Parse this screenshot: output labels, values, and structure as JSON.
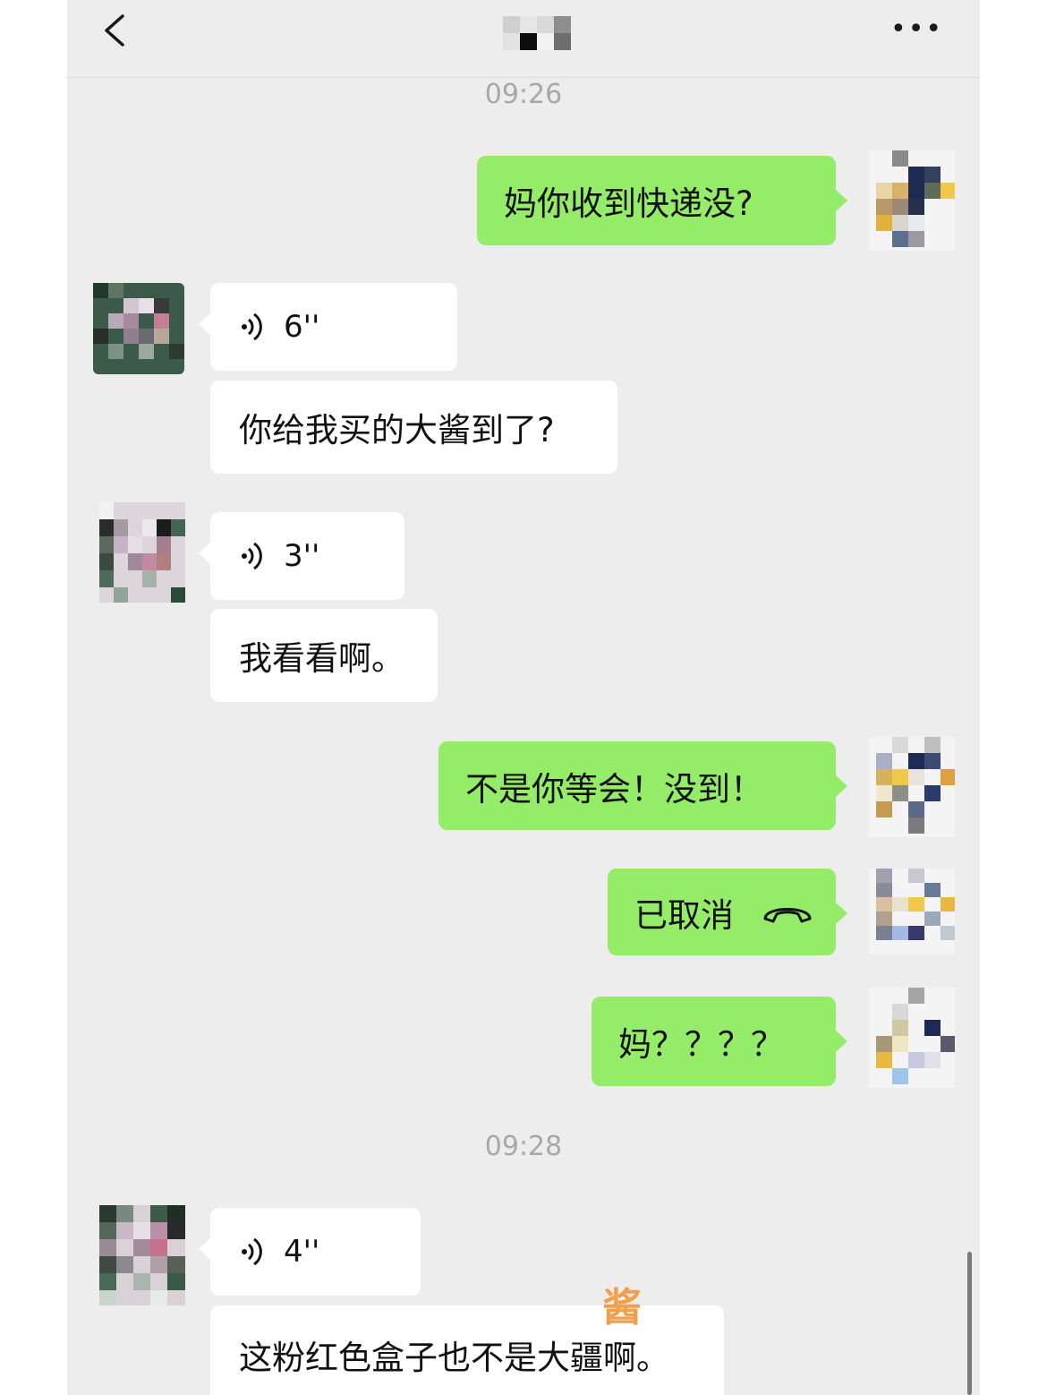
{
  "header": {
    "back_icon": "chevron-left-icon",
    "more_label": "•••"
  },
  "times": [
    "09:26",
    "09:28"
  ],
  "messages": {
    "m1": {
      "text": "妈你收到快递没?"
    },
    "m2": {
      "duration": "6''"
    },
    "m3": {
      "text": "你给我买的大酱到了?"
    },
    "m4": {
      "duration": "3''"
    },
    "m5": {
      "text": "我看看啊。"
    },
    "m6": {
      "text": "不是你等会！没到！"
    },
    "m7": {
      "text": "已取消"
    },
    "m8": {
      "text": "妈？？？？"
    },
    "m9": {
      "duration": "4''"
    },
    "m10": {
      "text": "这粉红色盒子也不是大疆啊。"
    }
  },
  "annotation": {
    "text": "酱",
    "color": "#f0a04b"
  },
  "colors": {
    "outgoing_bubble": "#95ec69",
    "incoming_bubble": "#ffffff",
    "background": "#ededed"
  }
}
